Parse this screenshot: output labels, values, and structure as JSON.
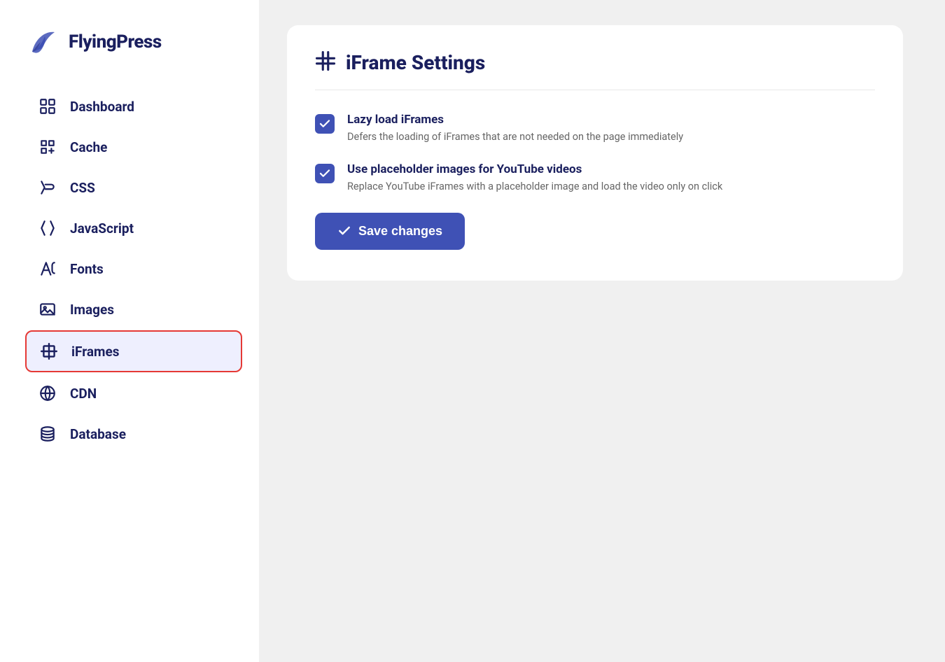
{
  "brand": {
    "name": "FlyingPress"
  },
  "sidebar": {
    "items": [
      {
        "id": "dashboard",
        "label": "Dashboard",
        "icon": "dashboard-icon",
        "active": false
      },
      {
        "id": "cache",
        "label": "Cache",
        "icon": "cache-icon",
        "active": false
      },
      {
        "id": "css",
        "label": "CSS",
        "icon": "css-icon",
        "active": false
      },
      {
        "id": "javascript",
        "label": "JavaScript",
        "icon": "javascript-icon",
        "active": false
      },
      {
        "id": "fonts",
        "label": "Fonts",
        "icon": "fonts-icon",
        "active": false
      },
      {
        "id": "images",
        "label": "Images",
        "icon": "images-icon",
        "active": false
      },
      {
        "id": "iframes",
        "label": "iFrames",
        "icon": "iframes-icon",
        "active": true
      },
      {
        "id": "cdn",
        "label": "CDN",
        "icon": "cdn-icon",
        "active": false
      },
      {
        "id": "database",
        "label": "Database",
        "icon": "database-icon",
        "active": false
      }
    ]
  },
  "main": {
    "page_title": "iFrame Settings",
    "settings": [
      {
        "id": "lazy_load",
        "title": "Lazy load iFrames",
        "description": "Defers the loading of iFrames that are not needed on the page immediately",
        "checked": true
      },
      {
        "id": "placeholder_images",
        "title": "Use placeholder images for YouTube videos",
        "description": "Replace YouTube iFrames with a placeholder image and load the video only on click",
        "checked": true
      }
    ],
    "save_button_label": "Save changes"
  }
}
